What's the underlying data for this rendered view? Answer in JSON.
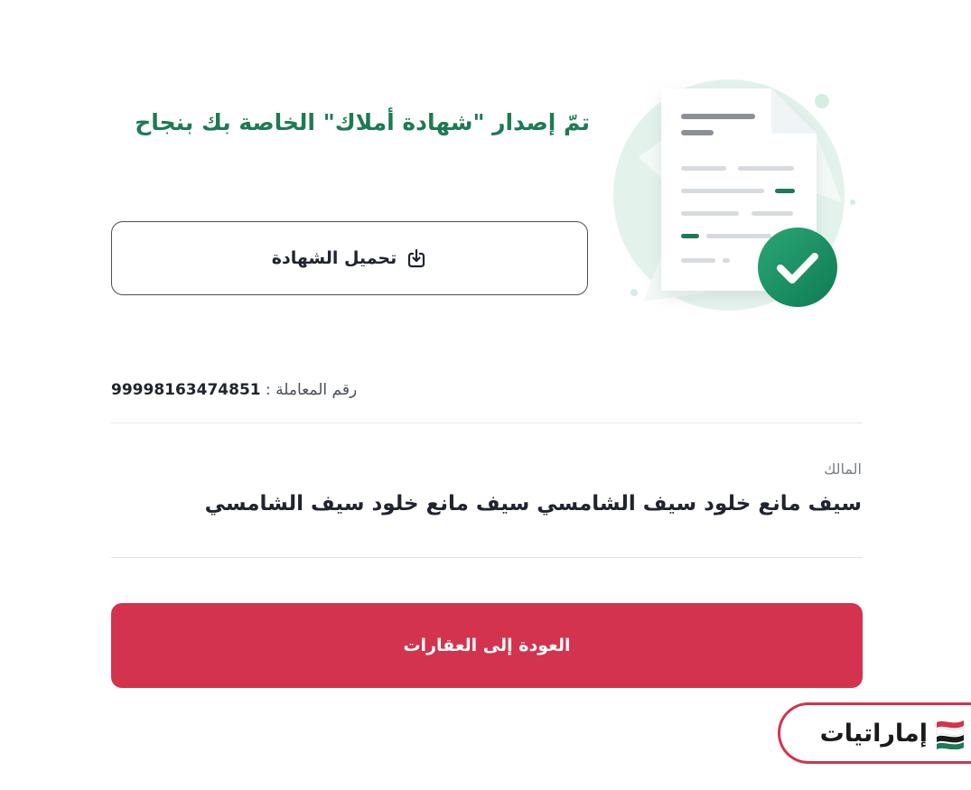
{
  "success": {
    "title": "تمّ إصدار \"شهادة أملاك\" الخاصة بك بنجاح"
  },
  "download": {
    "label": "تحميل الشهادة",
    "icon": "download-icon"
  },
  "transaction": {
    "label": "رقم المعاملة :",
    "number": "99998163474851"
  },
  "owner": {
    "label": "المالك",
    "value": "سيف مانع خلود سيف الشامسي سيف مانع خلود سيف الشامسي"
  },
  "back": {
    "label": "العودة إلى العقارات"
  },
  "brand": {
    "name": "إماراتيات",
    "icon": "uae-flag-icon"
  },
  "colors": {
    "primary_green": "#1e7a55",
    "accent_red": "#d3334d",
    "text_dark": "#1f2430"
  }
}
